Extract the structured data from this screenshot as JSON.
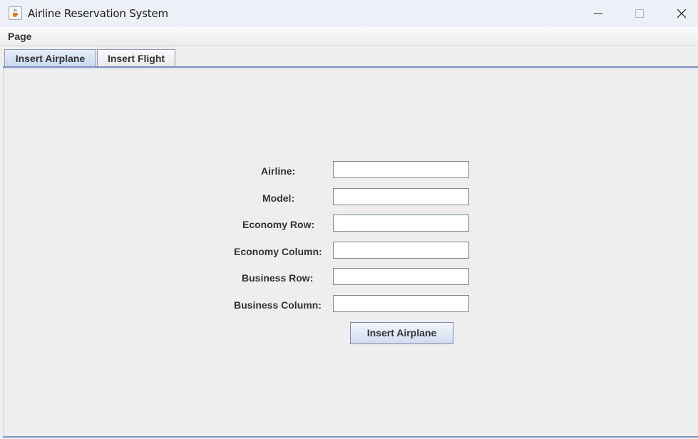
{
  "window": {
    "title": "Airline Reservation System",
    "controls": {
      "minimize_icon": "minimize-icon",
      "maximize_icon": "maximize-icon",
      "close_icon": "close-icon"
    },
    "app_icon": "java-cup-icon"
  },
  "menubar": {
    "items": [
      {
        "label": "Page"
      }
    ]
  },
  "tabs": [
    {
      "label": "Insert Airplane",
      "selected": true
    },
    {
      "label": "Insert Flight",
      "selected": false
    }
  ],
  "form": {
    "fields": [
      {
        "label": "Airline:",
        "value": ""
      },
      {
        "label": "Model:",
        "value": ""
      },
      {
        "label": "Economy Row:",
        "value": ""
      },
      {
        "label": "Economy Column:",
        "value": ""
      },
      {
        "label": "Business Row:",
        "value": ""
      },
      {
        "label": "Business Column:",
        "value": ""
      }
    ],
    "submit_label": "Insert Airplane"
  },
  "colors": {
    "selected_tab": "#c8d8ee",
    "tab_border": "#7f95bd"
  }
}
